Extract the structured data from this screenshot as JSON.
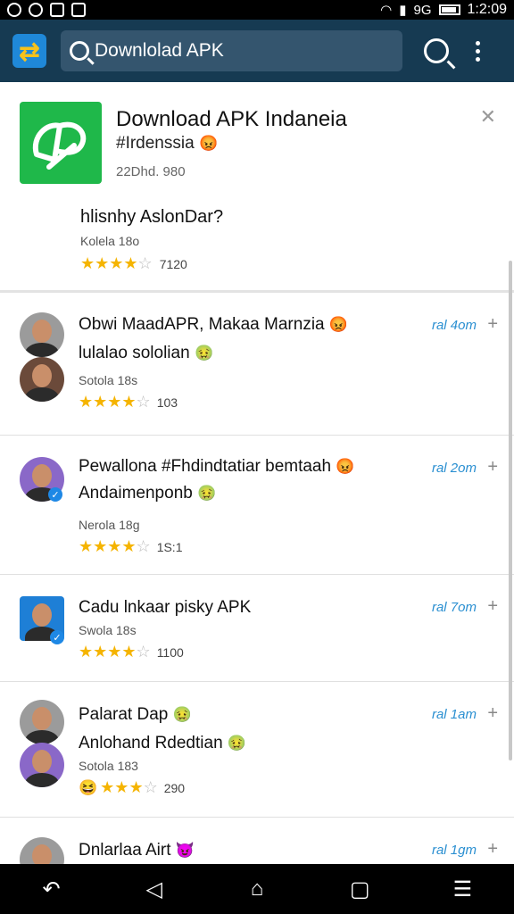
{
  "status_bar": {
    "time": "1:2:09",
    "signal_label": "9G"
  },
  "toolbar": {
    "search_text": "Downlolad APK"
  },
  "featured": {
    "title": "Download APK Indaneia",
    "subtitle": "#Irdenssia",
    "meta": "22Dhd. 980",
    "question": "hlisnhy AslonDar?",
    "category": "Kolela 18o",
    "rating_count": "7120",
    "stars": 4
  },
  "list": [
    {
      "title": "Obwi MaadAPR, Makaa Marnzia",
      "subtitle": "lulalao sololian",
      "category": "Sotola 18s",
      "rating_count": "103",
      "time": "ral 4om",
      "stars": 4
    },
    {
      "title": "Pewallona #Fhdindtatiar bemtaah",
      "subtitle": "Andaimenponb",
      "category": "Nerola 18g",
      "rating_count": "1S:1",
      "time": "ral 2om",
      "stars": 4
    },
    {
      "title": "Cadu lnkaar pisky APK",
      "subtitle": "",
      "category": "Swola 18s",
      "rating_count": "1100",
      "time": "ral 7om",
      "stars": 4
    },
    {
      "title": "Palarat Dap",
      "subtitle": "Anlohand Rdedtian",
      "category": "Sotola 183",
      "rating_count": "290",
      "time": "ral 1am",
      "stars": 4
    },
    {
      "title": "Dnlarlaa Airt",
      "subtitle": "",
      "category": "",
      "rating_count": "",
      "time": "ral 1gm",
      "stars": 0
    }
  ],
  "icons": {
    "app_logo": "arrows-logo-icon",
    "search": "search-icon",
    "overflow": "more-vert-icon",
    "close": "close-icon",
    "add": "plus-icon",
    "nav_back": "back-icon",
    "nav_triangle": "triangle-back-icon",
    "nav_home": "home-icon",
    "nav_recents": "recents-icon",
    "nav_menu": "menu-icon"
  },
  "colors": {
    "toolbar": "#163a52",
    "search_box": "#34556e",
    "accent_time": "#2a8fd1",
    "star": "#f5b400",
    "app_green": "#1fb84a"
  }
}
